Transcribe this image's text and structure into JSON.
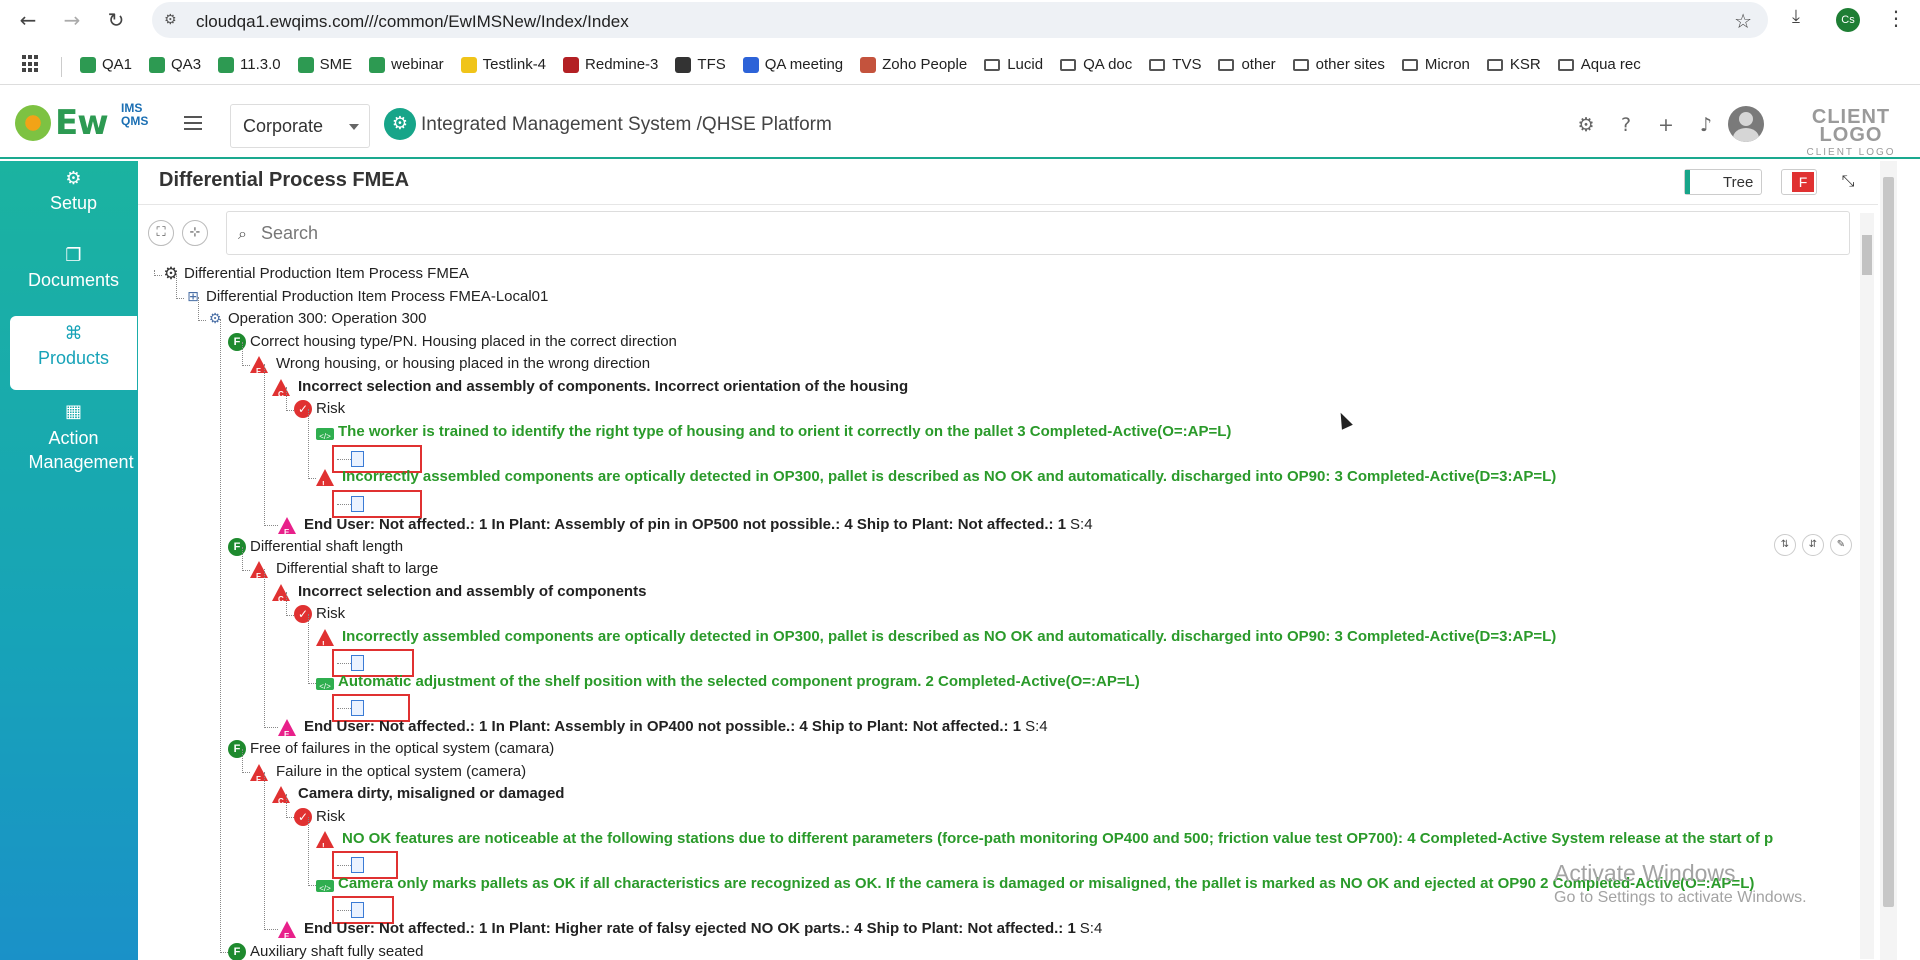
{
  "browser": {
    "url": "cloudqa1.ewqims.com///common/EwIMSNew/Index/Index",
    "profile_initials": "Cs",
    "bookmarks": [
      {
        "label": "QA1",
        "icon": "ewqims-icon",
        "type": "site"
      },
      {
        "label": "QA3",
        "icon": "ewqims-icon",
        "type": "site"
      },
      {
        "label": "11.3.0",
        "icon": "ewqims-icon",
        "type": "site"
      },
      {
        "label": "SME",
        "icon": "ewqims-icon",
        "type": "site"
      },
      {
        "label": "webinar",
        "icon": "ewqims-icon",
        "type": "site"
      },
      {
        "label": "Testlink-4",
        "icon": "testlink-icon",
        "type": "site"
      },
      {
        "label": "Redmine-3",
        "icon": "redmine-icon",
        "type": "site"
      },
      {
        "label": "TFS",
        "icon": "globe-icon",
        "type": "site"
      },
      {
        "label": "QA meeting",
        "icon": "zoom-icon",
        "type": "site"
      },
      {
        "label": "Zoho People",
        "icon": "zoho-icon",
        "type": "site"
      },
      {
        "label": "Lucid",
        "icon": "folder-icon",
        "type": "folder"
      },
      {
        "label": "QA doc",
        "icon": "folder-icon",
        "type": "folder"
      },
      {
        "label": "TVS",
        "icon": "folder-icon",
        "type": "folder"
      },
      {
        "label": "other",
        "icon": "folder-icon",
        "type": "folder"
      },
      {
        "label": "other sites",
        "icon": "folder-icon",
        "type": "folder"
      },
      {
        "label": "Micron",
        "icon": "folder-icon",
        "type": "folder"
      },
      {
        "label": "KSR",
        "icon": "folder-icon",
        "type": "folder"
      },
      {
        "label": "Aqua rec",
        "icon": "folder-icon",
        "type": "folder"
      }
    ]
  },
  "header": {
    "logo_main": "Ew",
    "logo_sub_top": "IMS",
    "logo_sub_bottom": "QMS",
    "org_selected": "Corporate",
    "platform_title": "Integrated Management System /QHSE Platform",
    "client_logo_big": "CLIENT LOGO",
    "client_logo_small": "CLIENT LOGO",
    "icons": [
      "gear-icon",
      "help-icon",
      "plus-icon",
      "bell-icon"
    ]
  },
  "sidebar": {
    "items": [
      {
        "label": "Setup",
        "icon": "gears-icon"
      },
      {
        "label": "Documents",
        "icon": "document-icon"
      },
      {
        "label": "Products",
        "icon": "products-icon",
        "active": true
      },
      {
        "label": "Action Management",
        "icon": "building-icon"
      }
    ]
  },
  "panel": {
    "title": "Differential Process FMEA",
    "view_toggle_label": "Tree",
    "f_badge": "F",
    "search_placeholder": "Search"
  },
  "tree": {
    "root": "Differential Production Item Process FMEA",
    "local": "Differential Production Item Process FMEA-Local01",
    "operation": "Operation 300: Operation 300",
    "f1": "Correct housing type/PN. Housing placed in the correct direction",
    "f1_mode": "Wrong housing, or housing placed in the wrong direction",
    "f1_cause": "Incorrect selection and assembly of components. Incorrect orientation of the housing",
    "f1_risk": "Risk",
    "f1_ctrl1": "The worker is trained to identify the right type of housing and to orient it correctly on the pallet 3 Completed-Active(O=:AP=L)",
    "f1_ctrl2": "Incorrectly assembled components are optically detected in OP300, pallet is described as NO OK and automatically. discharged into OP90: 3 Completed-Active(D=3:AP=L)",
    "f1_effect": "End User: Not affected.: 1 In Plant: Assembly of pin in OP500 not possible.: 4 Ship to Plant: Not affected.: 1",
    "f1_effect_sev": "S:4",
    "f2": "Differential shaft length",
    "f2_mode": "Differential shaft to large",
    "f2_cause": "Incorrect selection and assembly of components",
    "f2_risk": "Risk",
    "f2_ctrl1": "Incorrectly assembled components are optically detected in OP300, pallet is described as NO OK and automatically. discharged into OP90: 3 Completed-Active(D=3:AP=L)",
    "f2_ctrl2": "Automatic adjustment of the shelf position with the selected component program. 2 Completed-Active(O=:AP=L)",
    "f2_effect": "End User: Not affected.: 1 In Plant: Assembly in OP400 not possible.: 4 Ship to Plant: Not affected.: 1",
    "f2_effect_sev": "S:4",
    "f3": "Free of failures in the optical system (camara)",
    "f3_mode": "Failure in the optical system (camera)",
    "f3_cause": "Camera dirty, misaligned or damaged",
    "f3_risk": "Risk",
    "f3_ctrl1": "NO OK features are noticeable at the following stations due to different parameters (force-path monitoring OP400 and 500; friction value test OP700): 4 Completed-Active System release at the start of p",
    "f3_ctrl2": "Camera only marks pallets as OK if all characteristics are recognized as OK. If the camera is damaged or misaligned, the pallet is marked as NO OK and ejected at OP90 2 Completed-Active(O=:AP=L)",
    "f3_effect": "End User: Not affected.: 1 In Plant: Higher rate of falsy ejected NO OK parts.: 4 Ship to Plant: Not affected.: 1",
    "f3_effect_sev": "S:4",
    "f4_partial": "Auxiliary shaft fully seated"
  },
  "watermark": {
    "line1": "Activate Windows",
    "line2": "Go to Settings to activate Windows."
  },
  "colors": {
    "accent": "#17a589",
    "sidebar_top": "#1bb3a0",
    "sidebar_bottom": "#1a91c8",
    "control_text": "#2a9a2a",
    "danger": "#e03131"
  }
}
